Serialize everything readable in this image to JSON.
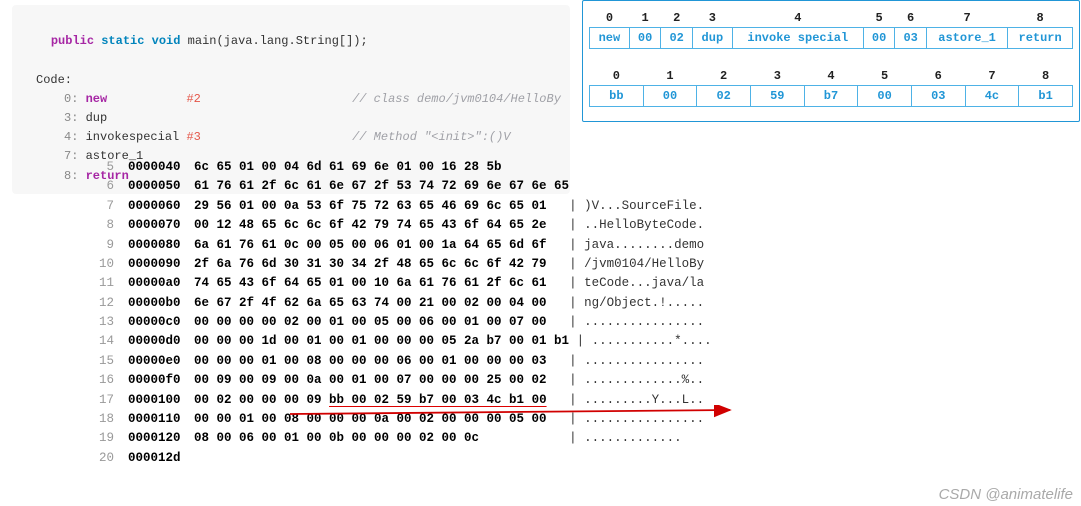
{
  "code": {
    "sig_kw1": "public",
    "sig_kw2": "static",
    "sig_kw3": "void",
    "sig_name": "main",
    "sig_args": "(java.lang.String[]);",
    "label": "Code:",
    "lines": [
      {
        "off": "0:",
        "op": "new",
        "arg": "#2",
        "comment": "// class demo/jvm0104/HelloBy"
      },
      {
        "off": "3:",
        "op": "dup",
        "arg": "",
        "comment": ""
      },
      {
        "off": "4:",
        "op": "invokespecial",
        "arg": "#3",
        "comment": "// Method \"<init>\":()V"
      },
      {
        "off": "7:",
        "op": "astore_1",
        "arg": "",
        "comment": ""
      },
      {
        "off": "8:",
        "op": "return",
        "arg": "",
        "comment": ""
      }
    ]
  },
  "table1": {
    "headers": [
      "0",
      "1",
      "2",
      "3",
      "4",
      "5",
      "6",
      "7",
      "8"
    ],
    "cells": [
      "new",
      "00",
      "02",
      "dup",
      "invoke special",
      "00",
      "03",
      "astore_1",
      "return"
    ]
  },
  "table2": {
    "headers": [
      "0",
      "1",
      "2",
      "3",
      "4",
      "5",
      "6",
      "7",
      "8"
    ],
    "cells": [
      "bb",
      "00",
      "02",
      "59",
      "b7",
      "00",
      "03",
      "4c",
      "b1"
    ]
  },
  "hexdump": [
    {
      "n": "5",
      "addr": "0000040",
      "bytes": "6c 65 01 00 04 6d 61 69 6e 01 00 16 28 5b",
      "ascii": ""
    },
    {
      "n": "6",
      "addr": "0000050",
      "bytes": "61 76 61 2f 6c 61 6e 67 2f 53 74 72 69 6e 67 6e 65",
      "ascii": ""
    },
    {
      "n": "7",
      "addr": "0000060",
      "bytes": "29 56 01 00 0a 53 6f 75 72 63 65 46 69 6c 65 01",
      "ascii": "| )V...SourceFile."
    },
    {
      "n": "8",
      "addr": "0000070",
      "bytes": "00 12 48 65 6c 6c 6f 42 79 74 65 43 6f 64 65 2e",
      "ascii": "| ..HelloByteCode."
    },
    {
      "n": "9",
      "addr": "0000080",
      "bytes": "6a 61 76 61 0c 00 05 00 06 01 00 1a 64 65 6d 6f",
      "ascii": "| java........demo"
    },
    {
      "n": "10",
      "addr": "0000090",
      "bytes": "2f 6a 76 6d 30 31 30 34 2f 48 65 6c 6c 6f 42 79",
      "ascii": "| /jvm0104/HelloBy"
    },
    {
      "n": "11",
      "addr": "00000a0",
      "bytes": "74 65 43 6f 64 65 01 00 10 6a 61 76 61 2f 6c 61",
      "ascii": "| teCode...java/la"
    },
    {
      "n": "12",
      "addr": "00000b0",
      "bytes": "6e 67 2f 4f 62 6a 65 63 74 00 21 00 02 00 04 00",
      "ascii": "| ng/Object.!....."
    },
    {
      "n": "13",
      "addr": "00000c0",
      "bytes": "00 00 00 00 02 00 01 00 05 00 06 00 01 00 07 00",
      "ascii": "| ................"
    },
    {
      "n": "14",
      "addr": "00000d0",
      "bytes": "00 00 00 1d 00 01 00 01 00 00 00 05 2a b7 00 01 b1",
      "ascii": "| ...........*...."
    },
    {
      "n": "15",
      "addr": "00000e0",
      "bytes": "00 00 00 01 00 08 00 00 00 06 00 01 00 00 00 03",
      "ascii": "| ................"
    },
    {
      "n": "16",
      "addr": "00000f0",
      "bytes": "00 09 00 09 00 0a 00 01 00 07 00 00 00 25 00 02",
      "ascii": "| .............%.."
    },
    {
      "n": "17",
      "addr": "0000100",
      "bytes": "00 02 00 00 00 09 ",
      "hi": "bb 00 02 59 b7 00 03 4c b1 00",
      "ascii": "| .........Y...L.."
    },
    {
      "n": "18",
      "addr": "0000110",
      "bytes": "00 00 01 00 08 00 00 00 0a 00 02 00 00 00 05 00",
      "ascii": "| ................"
    },
    {
      "n": "19",
      "addr": "0000120",
      "bytes": "08 00 06 00 01 00 0b 00 00 00 02 00 0c",
      "ascii": "| ............."
    },
    {
      "n": "20",
      "addr": "000012d",
      "bytes": "",
      "ascii": ""
    }
  ],
  "watermark": "CSDN @animatelife"
}
